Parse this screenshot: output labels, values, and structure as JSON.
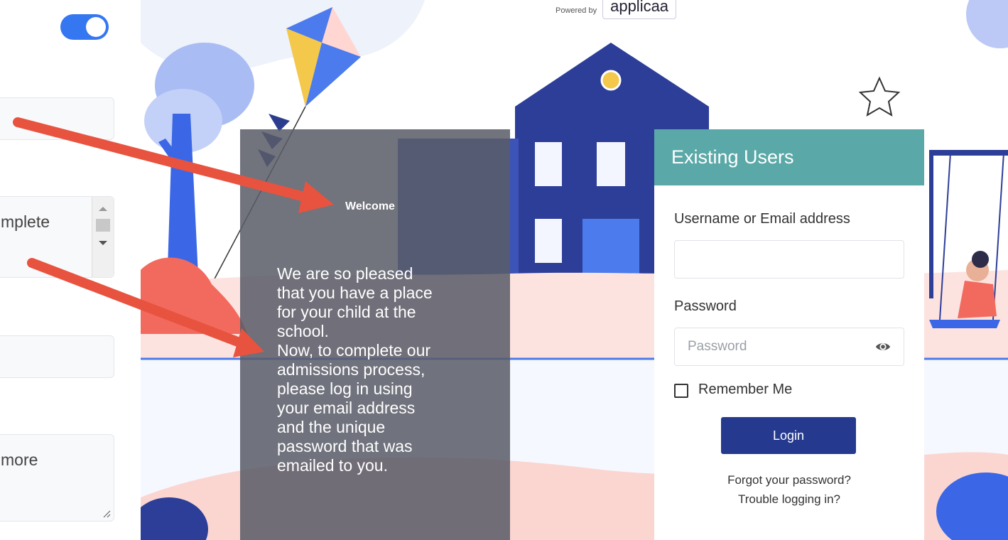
{
  "left_panel": {
    "fields": [
      {
        "text": ""
      },
      {
        "text": "mplete"
      },
      {
        "text": ""
      },
      {
        "text": "more"
      }
    ]
  },
  "header": {
    "powered_by": "Powered by",
    "brand": "applicaa"
  },
  "welcome": {
    "title": "Welcome",
    "body": "We are so pleased\nthat you have a place\nfor your child at the\nschool.\nNow, to complete our\nadmissions process,\nplease log in using\nyour email address\nand the unique\npassword that was\nemailed to you."
  },
  "login": {
    "title": "Existing Users",
    "username_label": "Username or Email address",
    "username_value": "",
    "password_label": "Password",
    "password_placeholder": "Password",
    "remember_label": "Remember Me",
    "login_button": "Login",
    "forgot_link": "Forgot your password?",
    "trouble_link": "Trouble logging in?"
  },
  "colors": {
    "accent_teal": "#5aa9a8",
    "button_navy": "#253a8e",
    "toggle_blue": "#3577f1",
    "annotation_arrow": "#e8533f"
  }
}
